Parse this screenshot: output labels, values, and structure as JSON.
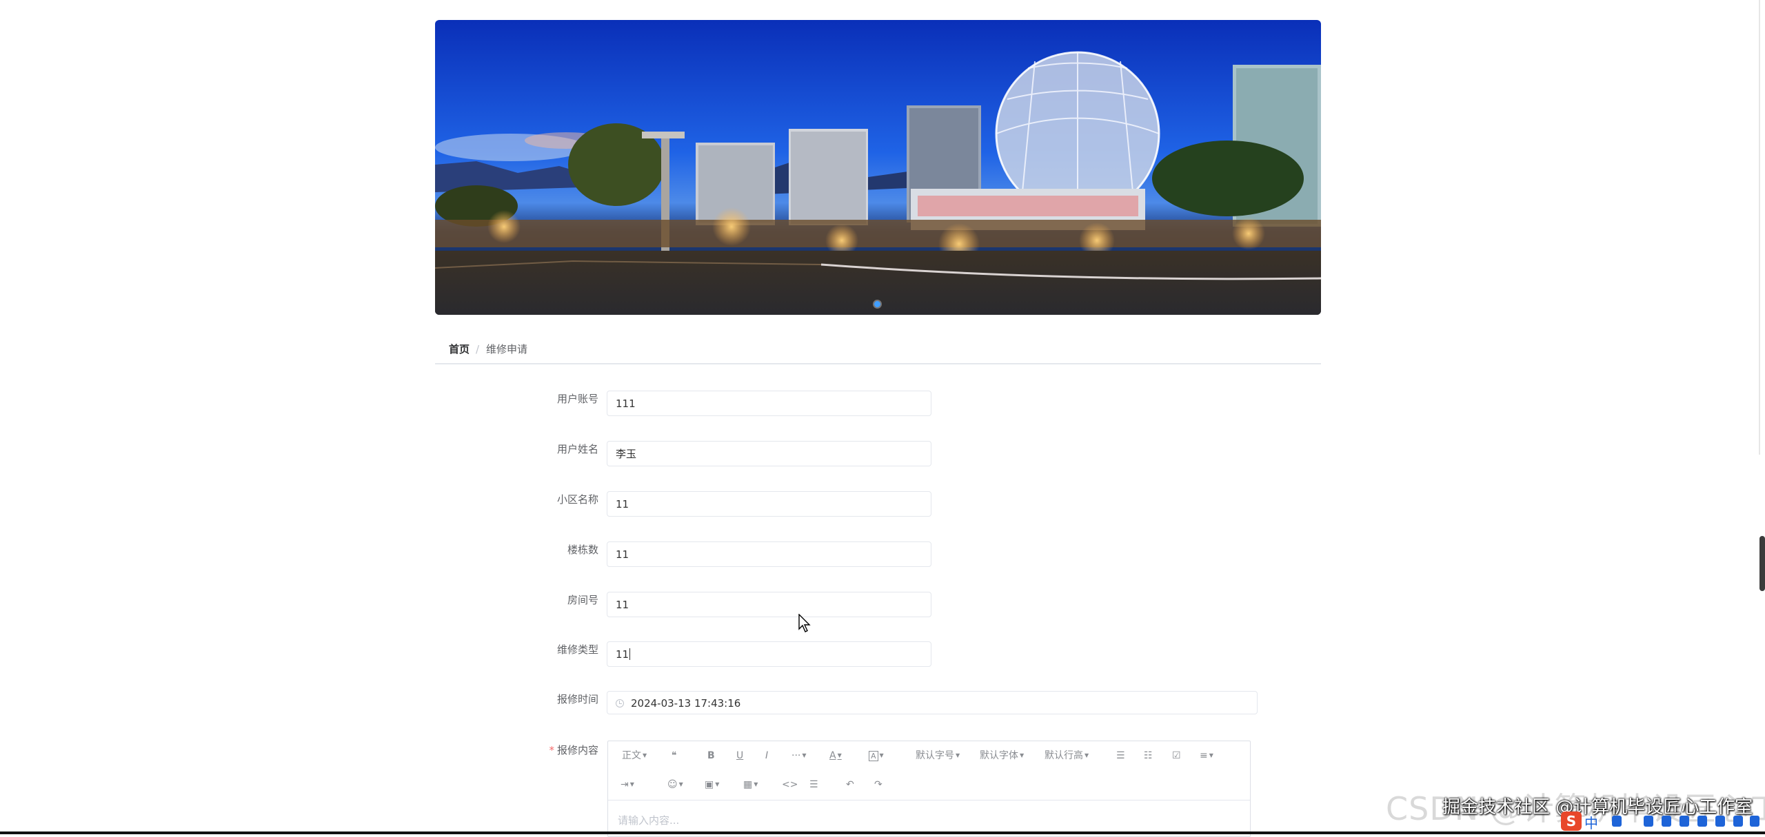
{
  "banner": {
    "image_alt": "city night skyline with geodesic dome",
    "active_slide": 1,
    "slide_count": 1
  },
  "breadcrumb": {
    "home": "首页",
    "separator": "/",
    "current": "维修申请"
  },
  "form": {
    "account": {
      "label": "用户账号",
      "value": "111"
    },
    "name": {
      "label": "用户姓名",
      "value": "李玉"
    },
    "community": {
      "label": "小区名称",
      "value": "11"
    },
    "building": {
      "label": "楼栋数",
      "value": "11"
    },
    "room": {
      "label": "房间号",
      "value": "11"
    },
    "repair_type": {
      "label": "维修类型",
      "value": "11"
    },
    "report_time": {
      "label": "报修时间",
      "value": "2024-03-13 17:43:16"
    },
    "content": {
      "label": "报修内容",
      "required_mark": "*"
    }
  },
  "editor": {
    "toolbar_row1": {
      "paragraph": "正文",
      "quote": "❝",
      "bold": "B",
      "underline": "U",
      "italic": "I",
      "more": "···",
      "font_color": "A",
      "bg_color": "A",
      "font_size": "默认字号",
      "font_family": "默认字体",
      "line_height": "默认行高",
      "bullet_list": "☰",
      "numbered_list": "☷",
      "todo": "☑",
      "align": "≡"
    },
    "toolbar_row2": {
      "indent": "⇥",
      "emoji": "☺",
      "image": "▣",
      "table": "▦",
      "code": "<>",
      "divider": "☰",
      "undo": "↶",
      "redo": "↷"
    },
    "placeholder": "请输入内容..."
  },
  "overlay": {
    "watermark": "掘金技术社区 @计算机毕设匠心工作室",
    "watermark_ghost": "CSDN @计算机毕设匠心工作室",
    "ime_logo": "S",
    "ime_lang": "中"
  },
  "colors": {
    "primary": "#409eff",
    "required": "#f56c6c",
    "border": "#e4e7ed"
  }
}
